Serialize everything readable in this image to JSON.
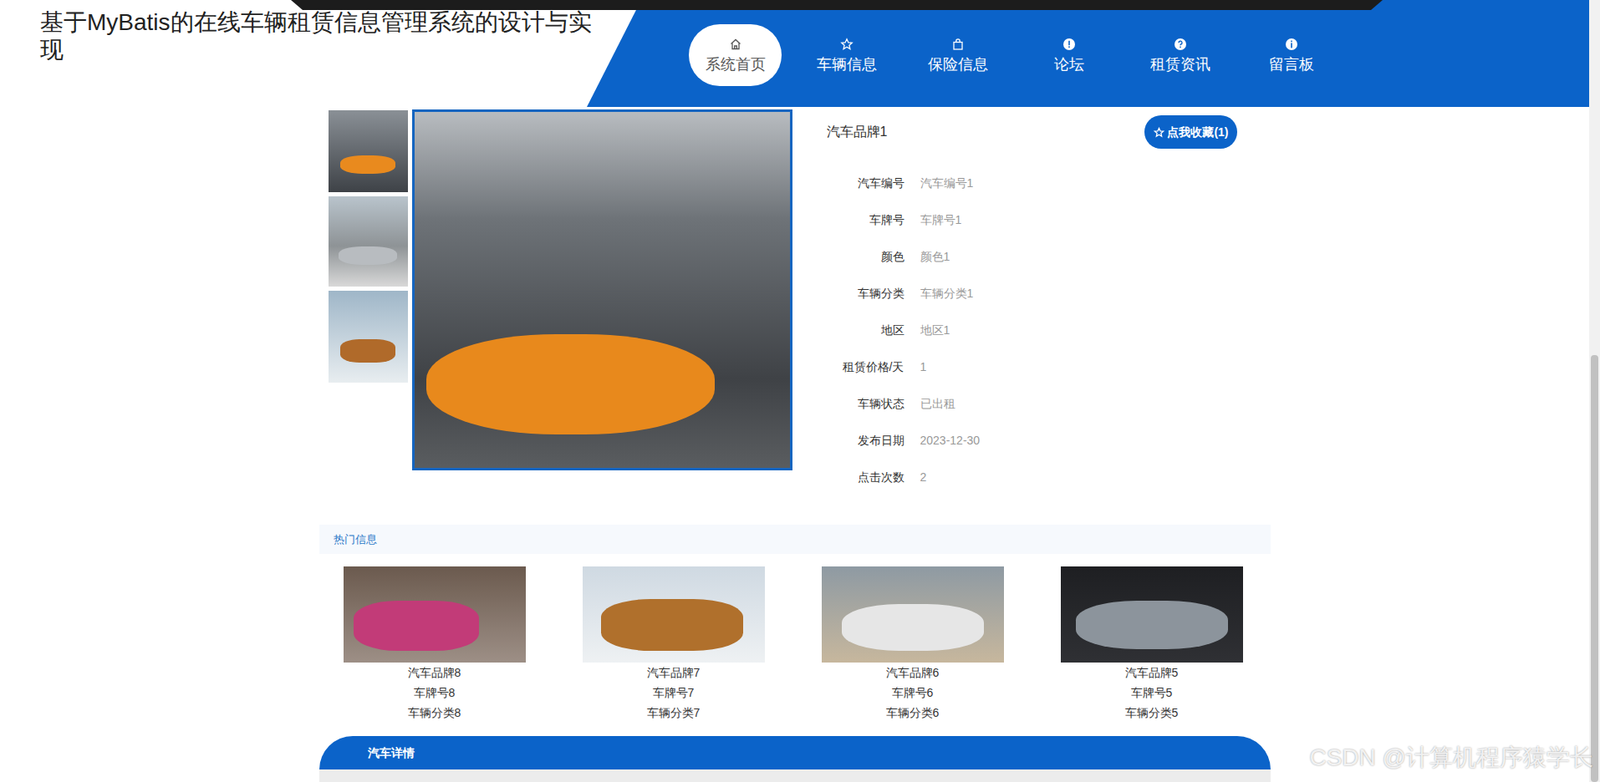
{
  "header": {
    "title": "基于MyBatis的在线车辆租赁信息管理系统的设计与实现"
  },
  "nav": [
    {
      "label": "系统首页",
      "selected": true
    },
    {
      "label": "车辆信息",
      "selected": false
    },
    {
      "label": "保险信息",
      "selected": false
    },
    {
      "label": "论坛",
      "selected": false
    },
    {
      "label": "租赁资讯",
      "selected": false
    },
    {
      "label": "留言板",
      "selected": false
    }
  ],
  "detail": {
    "name": "汽车品牌1",
    "favorite_button": "点我收藏(1)",
    "fields": [
      {
        "label": "汽车编号",
        "value": "汽车编号1"
      },
      {
        "label": "车牌号",
        "value": "车牌号1"
      },
      {
        "label": "颜色",
        "value": "颜色1"
      },
      {
        "label": "车辆分类",
        "value": "车辆分类1"
      },
      {
        "label": "地区",
        "value": "地区1"
      },
      {
        "label": "租赁价格/天",
        "value": "1"
      },
      {
        "label": "车辆状态",
        "value": "已出租"
      },
      {
        "label": "发布日期",
        "value": "2023-12-30"
      },
      {
        "label": "点击次数",
        "value": "2"
      }
    ]
  },
  "hot": {
    "title": "热门信息",
    "items": [
      {
        "lines": [
          "汽车品牌8",
          "车牌号8",
          "车辆分类8"
        ]
      },
      {
        "lines": [
          "汽车品牌7",
          "车牌号7",
          "车辆分类7"
        ]
      },
      {
        "lines": [
          "汽车品牌6",
          "车牌号6",
          "车辆分类6"
        ]
      },
      {
        "lines": [
          "汽车品牌5",
          "车牌号5",
          "车辆分类5"
        ]
      }
    ]
  },
  "details_tab": "汽车详情",
  "watermark": "CSDN @计算机程序猿学长"
}
